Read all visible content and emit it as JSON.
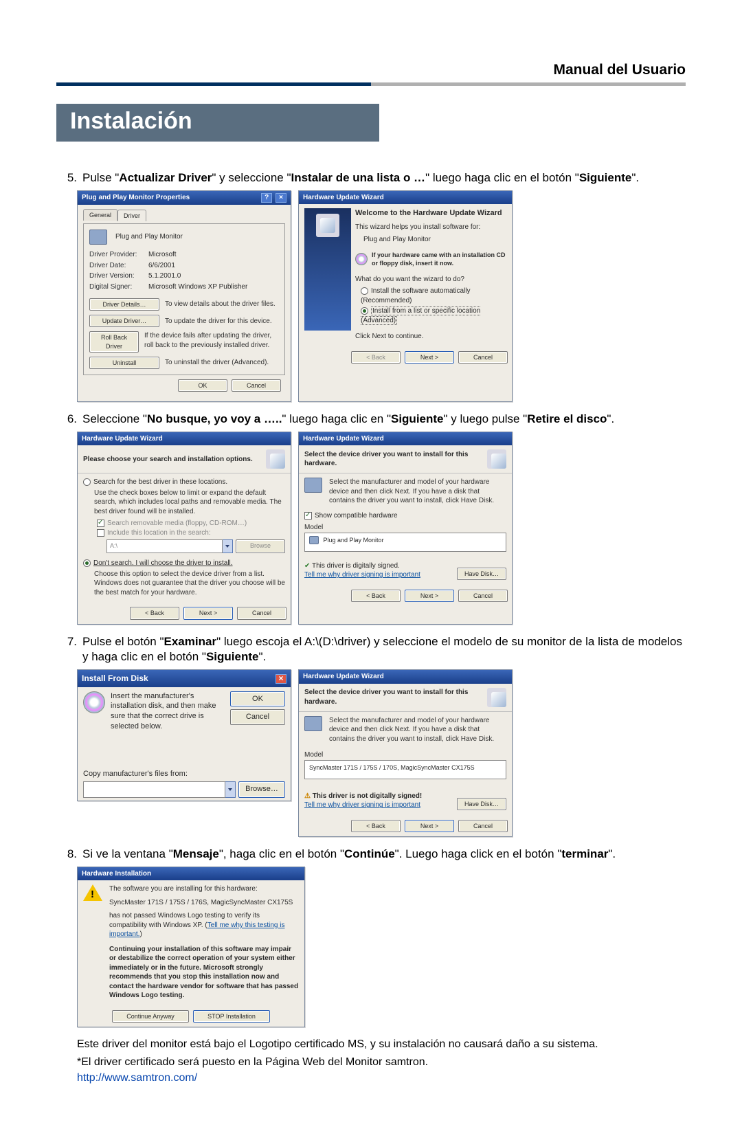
{
  "header": {
    "title": "Manual del Usuario"
  },
  "section": "Instalación",
  "steps": {
    "s5": {
      "num": "5.",
      "pre": "Pulse \"",
      "b1": "Actualizar Driver",
      "mid1": "\" y seleccione \"",
      "b2": "Instalar de una lista o …",
      "mid2": "\" luego haga clic en el botón \"",
      "b3": "Siguiente",
      "post": "\"."
    },
    "s6": {
      "num": "6.",
      "pre": "Seleccione \"",
      "b1": "No busque, yo voy a …..",
      "mid1": "\" luego haga clic en \"",
      "b2": "Siguiente",
      "mid2": "\" y luego pulse \"",
      "b3": "Retire el disco",
      "post": "\"."
    },
    "s7": {
      "num": "7.",
      "pre": "Pulse el botón \"",
      "b1": "Examinar",
      "mid1": "\" luego escoja el A:\\(D:\\driver) y seleccione el modelo de su monitor de la lista de modelos y haga clic en el botón \"",
      "b2": "Siguiente",
      "post": "\"."
    },
    "s8": {
      "num": "8.",
      "pre": "Si ve la ventana \"",
      "b1": "Mensaje",
      "mid1": "\", haga clic en el botón \"",
      "b2": "Continúe",
      "mid2": "\". Luego haga click en el botón \"",
      "b3": "terminar",
      "post": "\"."
    }
  },
  "shot1a": {
    "title": "Plug and Play Monitor Properties",
    "tab_general": "General",
    "tab_driver": "Driver",
    "device": "Plug and Play Monitor",
    "provider_l": "Driver Provider:",
    "provider_v": "Microsoft",
    "date_l": "Driver Date:",
    "date_v": "6/6/2001",
    "version_l": "Driver Version:",
    "version_v": "5.1.2001.0",
    "signer_l": "Digital Signer:",
    "signer_v": "Microsoft Windows XP Publisher",
    "details_btn": "Driver Details…",
    "details_d": "To view details about the driver files.",
    "update_btn": "Update Driver…",
    "update_d": "To update the driver for this device.",
    "rollback_btn": "Roll Back Driver",
    "rollback_d": "If the device fails after updating the driver, roll back to the previously installed driver.",
    "uninstall_btn": "Uninstall",
    "uninstall_d": "To uninstall the driver (Advanced).",
    "ok": "OK",
    "cancel": "Cancel"
  },
  "shot1b": {
    "title": "Hardware Update Wizard",
    "heading": "Welcome to the Hardware Update Wizard",
    "intro": "This wizard helps you install software for:",
    "device": "Plug and Play Monitor",
    "cd_hint": "If your hardware came with an installation CD or floppy disk, insert it now.",
    "q": "What do you want the wizard to do?",
    "opt1": "Install the software automatically (Recommended)",
    "opt2": "Install from a list or specific location (Advanced)",
    "cont": "Click Next to continue.",
    "back": "< Back",
    "next": "Next >",
    "cancel": "Cancel"
  },
  "shot2a": {
    "title": "Hardware Update Wizard",
    "heading": "Please choose your search and installation options.",
    "opt1": "Search for the best driver in these locations.",
    "opt1d": "Use the check boxes below to limit or expand the default search, which includes local paths and removable media. The best driver found will be installed.",
    "chk1": "Search removable media (floppy, CD-ROM…)",
    "chk2": "Include this location in the search:",
    "path": "A:\\",
    "browse": "Browse",
    "opt2": "Don't search. I will choose the driver to install.",
    "opt2d": "Choose this option to select the device driver from a list. Windows does not guarantee that the driver you choose will be the best match for your hardware.",
    "back": "< Back",
    "next": "Next >",
    "cancel": "Cancel"
  },
  "shot2b": {
    "title": "Hardware Update Wizard",
    "heading": "Select the device driver you want to install for this hardware.",
    "instr": "Select the manufacturer and model of your hardware device and then click Next. If you have a disk that contains the driver you want to install, click Have Disk.",
    "show_compat": "Show compatible hardware",
    "model_l": "Model",
    "model_v": "Plug and Play Monitor",
    "signed": "This driver is digitally signed.",
    "why": "Tell me why driver signing is important",
    "have_disk": "Have Disk…",
    "back": "< Back",
    "next": "Next >",
    "cancel": "Cancel"
  },
  "shot3a": {
    "title": "Install From Disk",
    "instr": "Insert the manufacturer's installation disk, and then make sure that the correct drive is selected below.",
    "ok": "OK",
    "cancel": "Cancel",
    "copy_l": "Copy manufacturer's files from:",
    "path": "",
    "browse": "Browse…"
  },
  "shot3b": {
    "title": "Hardware Update Wizard",
    "heading": "Select the device driver you want to install for this hardware.",
    "instr": "Select the manufacturer and model of your hardware device and then click Next. If you have a disk that contains the driver you want to install, click Have Disk.",
    "model_l": "Model",
    "model_v": "SyncMaster 171S / 175S / 170S, MagicSyncMaster CX175S",
    "not_signed": "This driver is not digitally signed!",
    "why": "Tell me why driver signing is important",
    "have_disk": "Have Disk…",
    "back": "< Back",
    "next": "Next >",
    "cancel": "Cancel"
  },
  "shot4": {
    "title": "Hardware Installation",
    "line1": "The software you are installing for this hardware:",
    "device": "SyncMaster 171S / 175S / 176S, MagicSyncMaster CX175S",
    "line2a": "has not passed Windows Logo testing to verify its compatibility with Windows XP. (",
    "line2link": "Tell me why this testing is important.",
    "line2b": ")",
    "warn": "Continuing your installation of this software may impair or destabilize the correct operation of your system either immediately or in the future. Microsoft strongly recommends that you stop this installation now and contact the hardware vendor for software that has passed Windows Logo testing.",
    "cont": "Continue Anyway",
    "stop": "STOP Installation"
  },
  "closing": {
    "p1": "Este driver del monitor está bajo el Logotipo certificado MS, y su instalación no causará daño a su sistema.",
    "p2": "*El driver certificado será puesto en la Página Web del Monitor samtron.",
    "url": "http://www.samtron.com/"
  }
}
